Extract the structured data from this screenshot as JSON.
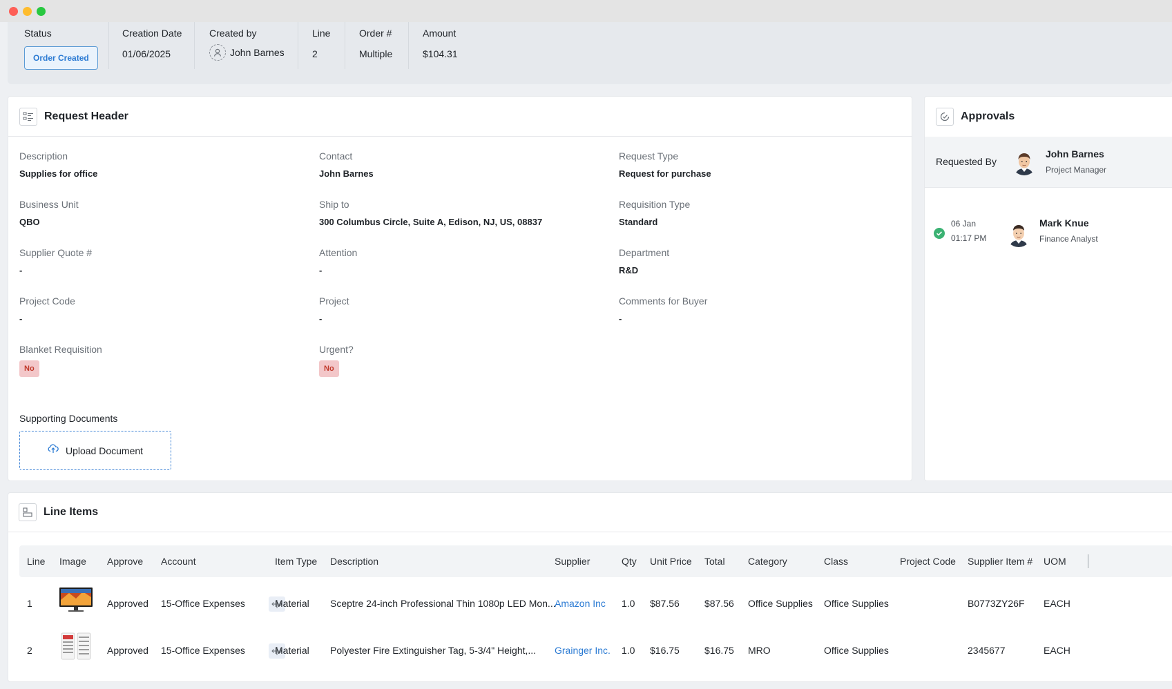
{
  "summary": {
    "status": {
      "label": "Status",
      "value": "Order Created"
    },
    "creation_date": {
      "label": "Creation Date",
      "value": "01/06/2025"
    },
    "created_by": {
      "label": "Created by",
      "value": "John Barnes"
    },
    "line": {
      "label": "Line",
      "value": "2"
    },
    "order": {
      "label": "Order #",
      "value": "Multiple"
    },
    "amount": {
      "label": "Amount",
      "value": "$104.31"
    }
  },
  "request_header": {
    "title": "Request Header",
    "fields": {
      "description": {
        "label": "Description",
        "value": "Supplies for office"
      },
      "contact": {
        "label": "Contact",
        "value": "John Barnes"
      },
      "request_type": {
        "label": "Request Type",
        "value": "Request for purchase"
      },
      "business_unit": {
        "label": "Business Unit",
        "value": "QBO"
      },
      "ship_to": {
        "label": "Ship to",
        "value": "300 Columbus Circle, Suite A, Edison, NJ, US, 08837"
      },
      "requisition_type": {
        "label": "Requisition Type",
        "value": "Standard"
      },
      "supplier_quote": {
        "label": "Supplier Quote #",
        "value": "-"
      },
      "attention": {
        "label": "Attention",
        "value": "-"
      },
      "department": {
        "label": "Department",
        "value": "R&D"
      },
      "project_code": {
        "label": "Project Code",
        "value": "-"
      },
      "project": {
        "label": "Project",
        "value": "-"
      },
      "comments_buyer": {
        "label": "Comments for Buyer",
        "value": "-"
      },
      "blanket_requisition": {
        "label": "Blanket Requisition",
        "value": "No"
      },
      "urgent": {
        "label": "Urgent?",
        "value": "No"
      }
    },
    "supporting_documents": "Supporting Documents",
    "upload_label": "Upload Document"
  },
  "approvals": {
    "title": "Approvals",
    "requested_by_label": "Requested By",
    "requester": {
      "name": "John Barnes",
      "role": "Project Manager"
    },
    "approvers": [
      {
        "date": "06 Jan",
        "time": "01:17 PM",
        "name": "Mark Knue",
        "role": "Finance Analyst",
        "status_color": "#3bb273"
      }
    ]
  },
  "line_items": {
    "title": "Line Items",
    "columns": [
      "Line",
      "Image",
      "Approve",
      "Account",
      "Item Type",
      "Description",
      "Supplier",
      "Qty",
      "Unit Price",
      "Total",
      "Category",
      "Class",
      "Project Code",
      "Supplier Item #",
      "UOM"
    ],
    "rows": [
      {
        "line": "1",
        "approve": "Approved",
        "account": "15-Office Expenses",
        "item_type": "Material",
        "description": "Sceptre 24-inch Professional Thin 1080p LED Mon...",
        "supplier": "Amazon Inc",
        "qty": "1.0",
        "unit_price": "$87.56",
        "total": "$87.56",
        "category": "Office Supplies",
        "class": "Office Supplies",
        "project_code": "",
        "supplier_item": "B0773ZY26F",
        "uom": "EACH",
        "image_icon": "monitor-icon"
      },
      {
        "line": "2",
        "approve": "Approved",
        "account": "15-Office Expenses",
        "item_type": "Material",
        "description": "Polyester Fire Extinguisher Tag, 5-3/4\" Height,...",
        "supplier": "Grainger Inc.",
        "qty": "1.0",
        "unit_price": "$16.75",
        "total": "$16.75",
        "category": "MRO",
        "class": "Office Supplies",
        "project_code": "",
        "supplier_item": "2345677",
        "uom": "EACH",
        "image_icon": "tag-icon"
      }
    ]
  },
  "colors": {
    "accent": "#2a7ad3",
    "danger_bg": "#f3c7c9",
    "danger_text": "#c0392b",
    "success": "#3bb273"
  }
}
